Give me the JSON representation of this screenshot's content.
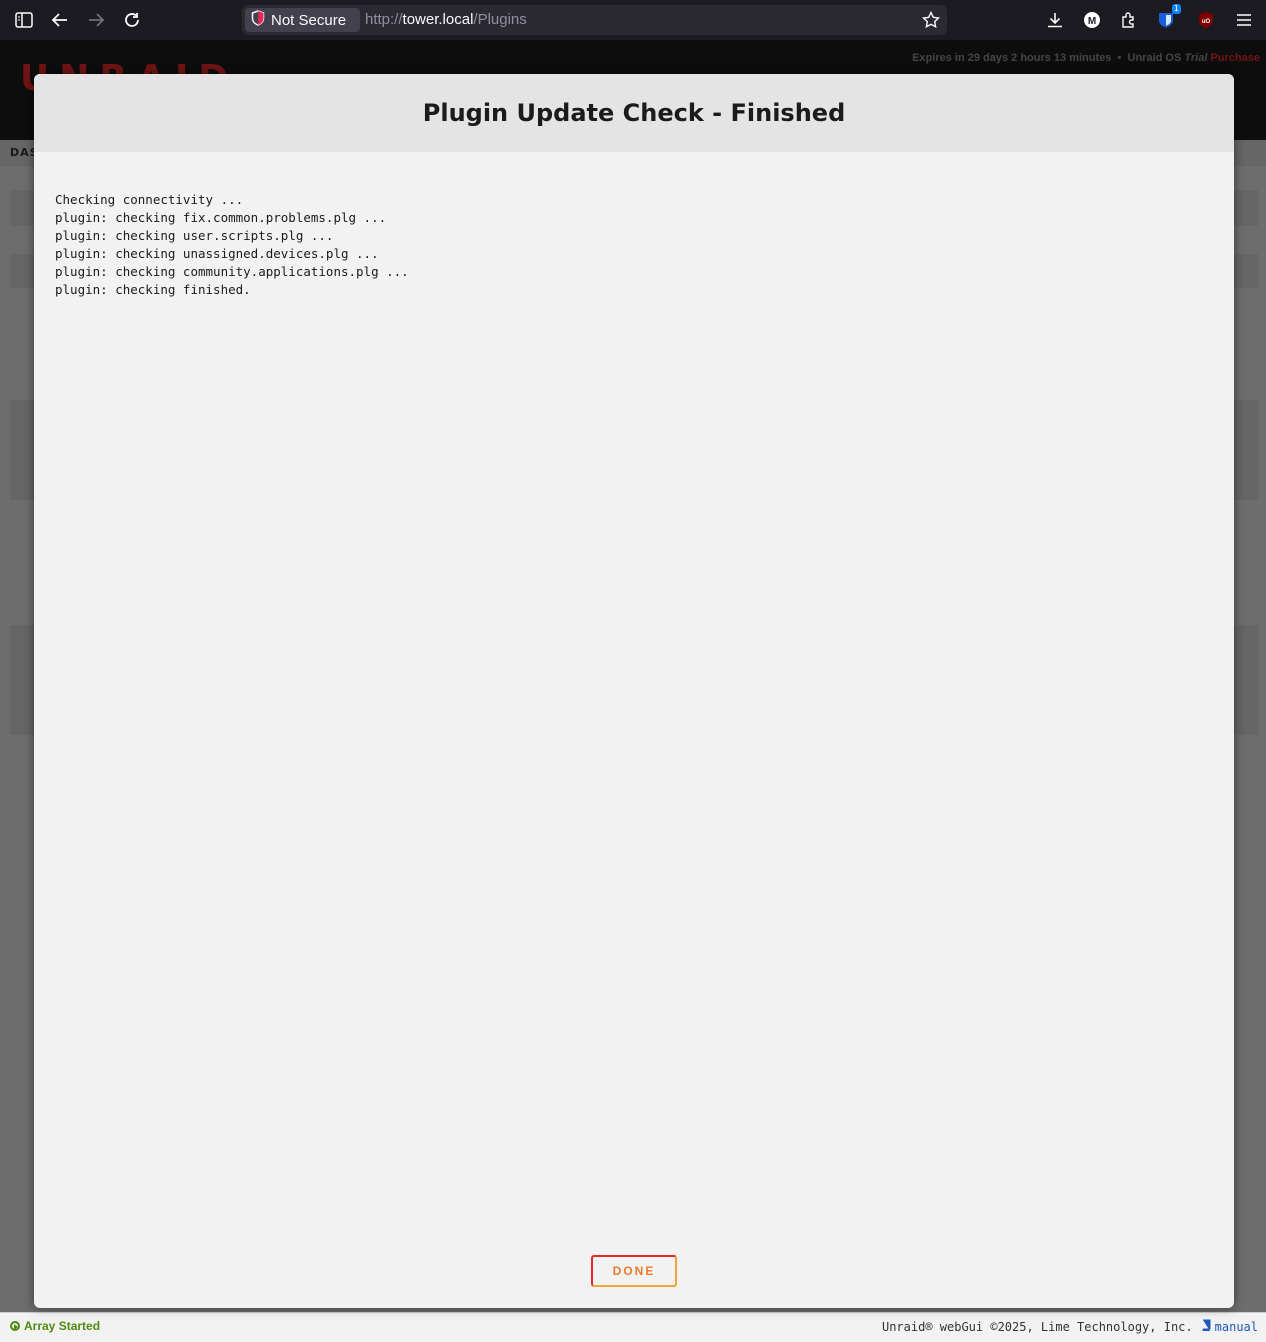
{
  "browser": {
    "security_label": "Not Secure",
    "url_scheme": "http://",
    "url_host": "tower.local",
    "url_path": "/Plugins",
    "extension_badge": "1",
    "icons": [
      "sidebar-icon",
      "back-icon",
      "forward-icon",
      "reload-icon",
      "shield-warning-icon",
      "bookmark-star-icon",
      "download-icon",
      "account-icon",
      "extensions-icon",
      "bitwarden-icon",
      "ublock-icon",
      "menu-icon"
    ]
  },
  "page": {
    "trial_expiry": "Expires in 29 days 2 hours 13 minutes",
    "separator": "•",
    "os_label": "Unraid OS",
    "trial_label": "Trial",
    "purchase_label": "Purchase",
    "logo_text": "UNRAID",
    "nav_label": "DAS",
    "colors": {
      "accent": "#e22828",
      "accent_orange": "#ed7a2d",
      "status_green": "#4f8a10"
    }
  },
  "modal": {
    "title": "Plugin Update Check - Finished",
    "log": "Checking connectivity ...\nplugin: checking fix.common.problems.plg ...\nplugin: checking user.scripts.plg ...\nplugin: checking unassigned.devices.plg ...\nplugin: checking community.applications.plg ...\nplugin: checking finished.",
    "done_label": "DONE"
  },
  "footer": {
    "status": "Array Started",
    "copyright": "Unraid® webGui ©2025, Lime Technology, Inc.",
    "manual_label": "manual"
  }
}
